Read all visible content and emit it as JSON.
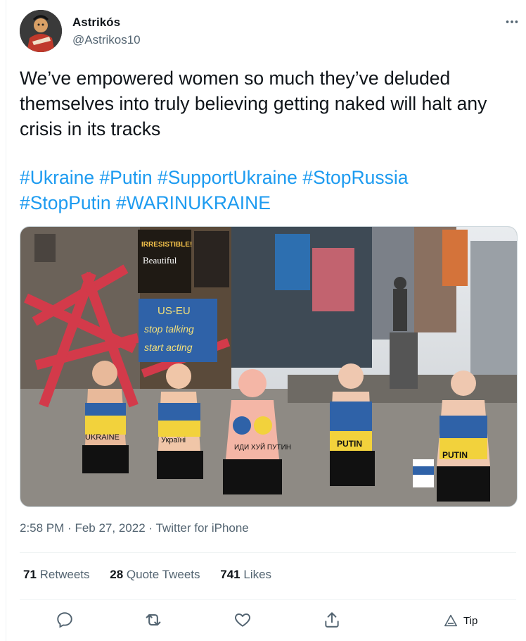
{
  "tweet": {
    "author_name": "Astrikós",
    "author_handle": "@Astrikos10",
    "text": "We’ve empowered women so much they’ve deluded themselves into truly believing getting naked will halt any crisis in its tracks",
    "hashtags": [
      "#Ukraine",
      "#Putin",
      "#SupportUkraine",
      "#StopRussia",
      "#StopPutin",
      "#WARINUKRAINE"
    ],
    "time": "2:58 PM",
    "date": "Feb 27, 2022",
    "separator": "·",
    "source": "Twitter for iPhone"
  },
  "media": {
    "sign_line1": "US-EU",
    "sign_line2": "stop talking",
    "sign_line3": "start acting",
    "billboard_1": "IRRESISTIBLE!",
    "billboard_2": "Beautiful",
    "body_text_1": "UKRAINE",
    "body_text_2": "Україні",
    "body_text_3": "ИДИ ХУЙ ПУТИН",
    "body_text_4": "PUTIN",
    "body_text_5": "PUTIN"
  },
  "stats": {
    "retweets_count": "71",
    "retweets_label": "Retweets",
    "quotes_count": "28",
    "quotes_label": "Quote Tweets",
    "likes_count": "741",
    "likes_label": "Likes"
  },
  "actions": {
    "tip_label": "Tip"
  },
  "colors": {
    "link": "#1d9bf0",
    "secondary_text": "#536471",
    "primary_text": "#0f1419"
  },
  "icons": [
    "more-icon",
    "reply-icon",
    "retweet-icon",
    "like-icon",
    "share-icon",
    "tip-icon"
  ]
}
